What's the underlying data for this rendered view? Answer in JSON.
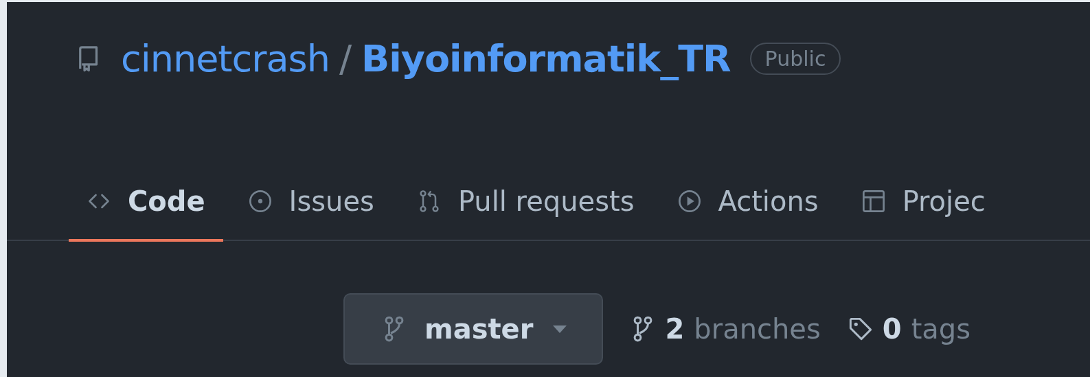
{
  "repo": {
    "owner": "cinnetcrash",
    "separator": "/",
    "name": "Biyoinformatik_TR",
    "visibility": "Public"
  },
  "tabs": [
    {
      "label": "Code",
      "kind": "code",
      "selected": true
    },
    {
      "label": "Issues",
      "kind": "issue",
      "selected": false
    },
    {
      "label": "Pull requests",
      "kind": "pr",
      "selected": false
    },
    {
      "label": "Actions",
      "kind": "play",
      "selected": false
    },
    {
      "label": "Projec",
      "kind": "table",
      "selected": false
    }
  ],
  "branch_button": {
    "label": "master"
  },
  "branches": {
    "count": "2",
    "label": "branches"
  },
  "tags": {
    "count": "0",
    "label": "tags"
  }
}
